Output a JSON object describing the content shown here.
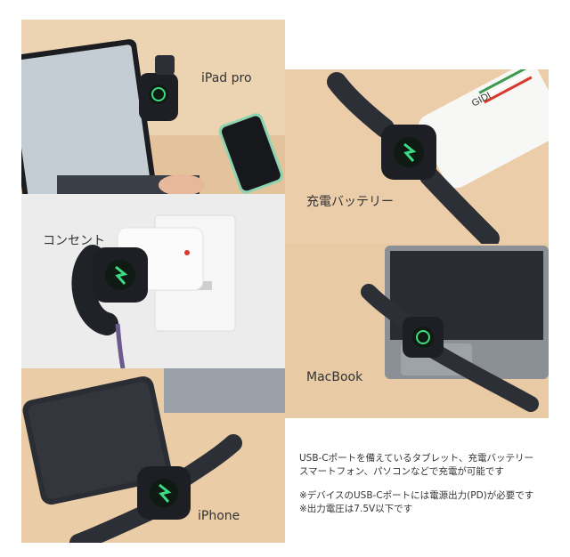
{
  "labels": {
    "ipad": "iPad pro",
    "battery": "充電バッテリー",
    "outlet": "コンセント",
    "macbook": "MacBook",
    "iphone": "iPhone"
  },
  "brand": {
    "power_bank_logo": "GIDI"
  },
  "notes": {
    "line1": "USB-Cポートを備えているタブレット、充電バッテリー",
    "line2": "スマートフォン、パソコンなどで充電が可能です",
    "line3": "※デバイスのUSB-Cポートには電源出力(PD)が必要です",
    "line4": "※出力電圧は7.5V以下です"
  },
  "colors": {
    "wood": "#e8c9a3",
    "charge_green": "#3ddc84",
    "watch_band": "#2c2f36",
    "accent_red": "#d9382c"
  }
}
